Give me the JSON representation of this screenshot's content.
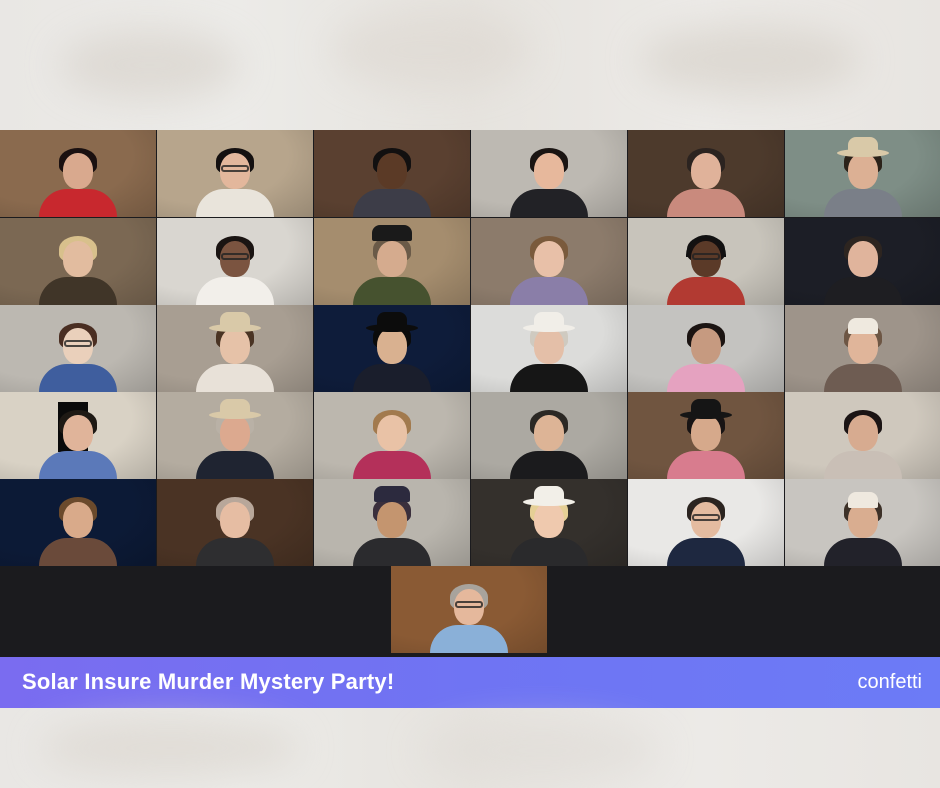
{
  "banner": {
    "title": "Solar Insure Murder Mystery Party!",
    "brand": "confetti"
  },
  "tiles": [
    {
      "row": 0,
      "col": 0,
      "bg": "#8a6a4e",
      "skin": "#d9a98e",
      "hair": "#1a1010",
      "top": "#c8282e",
      "acc": "none",
      "active": false
    },
    {
      "row": 0,
      "col": 1,
      "bg": "#b7a58c",
      "skin": "#e3b79c",
      "hair": "#141010",
      "top": "#e9e4db",
      "acc": "glasses",
      "active": true
    },
    {
      "row": 0,
      "col": 2,
      "bg": "#5a4030",
      "skin": "#5b3a26",
      "hair": "#121010",
      "top": "#3d3d48",
      "acc": "none",
      "active": false
    },
    {
      "row": 0,
      "col": 3,
      "bg": "#bdb9b2",
      "skin": "#e7b89c",
      "hair": "#1a1412",
      "top": "#222226",
      "acc": "none",
      "active": false
    },
    {
      "row": 0,
      "col": 4,
      "bg": "#4d3a2c",
      "skin": "#e0b29a",
      "hair": "#2b2320",
      "top": "#c98a7d",
      "acc": "none",
      "active": false
    },
    {
      "row": 0,
      "col": 5,
      "bg": "#7e8e86",
      "skin": "#dcb094",
      "hair": "#2b2219",
      "top": "#7a7f88",
      "acc": "cowboy",
      "active": false
    },
    {
      "row": 1,
      "col": 0,
      "bg": "#7b6853",
      "skin": "#e2bc9f",
      "hair": "#d8c08c",
      "top": "#403528",
      "acc": "none",
      "active": false
    },
    {
      "row": 1,
      "col": 1,
      "bg": "#d9d6d0",
      "skin": "#7b5440",
      "hair": "#1a1412",
      "top": "#f2efea",
      "acc": "glasses",
      "active": false
    },
    {
      "row": 1,
      "col": 2,
      "bg": "#a58d6e",
      "skin": "#d5ab8e",
      "hair": "#6a5a48",
      "top": "#46522f",
      "acc": "beret",
      "active": false
    },
    {
      "row": 1,
      "col": 3,
      "bg": "#8c7b6b",
      "skin": "#e8c0a8",
      "hair": "#7a5a3c",
      "top": "#8a7ea8",
      "acc": "none",
      "active": false
    },
    {
      "row": 1,
      "col": 4,
      "bg": "#c8c4bb",
      "skin": "#5b3a28",
      "hair": "#141010",
      "top": "#b23a32",
      "acc": "headset",
      "active": false
    },
    {
      "row": 1,
      "col": 5,
      "bg": "#1c1e26",
      "skin": "#e0b49c",
      "hair": "#2d2520",
      "top": "#1e1e22",
      "acc": "none",
      "active": false
    },
    {
      "row": 2,
      "col": 0,
      "bg": "#bcb8b1",
      "skin": "#ead0bb",
      "hair": "#4a2e22",
      "top": "#3f5e9e",
      "acc": "glasses",
      "active": false
    },
    {
      "row": 2,
      "col": 1,
      "bg": "#a89e92",
      "skin": "#e6c2a8",
      "hair": "#4a3424",
      "top": "#e8e1d8",
      "acc": "cowboy",
      "active": false
    },
    {
      "row": 2,
      "col": 2,
      "bg": "#0e1c3a",
      "skin": "#d9b190",
      "hair": "#0b0b0b",
      "top": "#1a1e2c",
      "acc": "tophat",
      "active": false
    },
    {
      "row": 2,
      "col": 3,
      "bg": "#dcdcda",
      "skin": "#e4bfa8",
      "hair": "#cfcac0",
      "top": "#161616",
      "acc": "panama",
      "active": false
    },
    {
      "row": 2,
      "col": 4,
      "bg": "#c4c3c0",
      "skin": "#c69a80",
      "hair": "#1b1412",
      "top": "#e5a2c0",
      "acc": "none",
      "active": false
    },
    {
      "row": 2,
      "col": 5,
      "bg": "#9e948a",
      "skin": "#e0b59a",
      "hair": "#6d5644",
      "top": "#6e5c52",
      "acc": "cap",
      "active": false
    },
    {
      "row": 3,
      "col": 0,
      "bg": "#d9d2c5",
      "skin": "#e0b49a",
      "hair": "#1e1914",
      "top": "#5b79b9",
      "acc": "sign",
      "active": false
    },
    {
      "row": 3,
      "col": 1,
      "bg": "#b4aca0",
      "skin": "#dca98f",
      "hair": "#b9b1a6",
      "top": "#1f2431",
      "acc": "cowboy",
      "active": false
    },
    {
      "row": 3,
      "col": 2,
      "bg": "#bcb7ae",
      "skin": "#e9c2a6",
      "hair": "#a27a4e",
      "top": "#b4305a",
      "acc": "none",
      "active": false
    },
    {
      "row": 3,
      "col": 3,
      "bg": "#aca9a2",
      "skin": "#ddb496",
      "hair": "#2b2824",
      "top": "#1b1b1d",
      "acc": "none",
      "active": false
    },
    {
      "row": 3,
      "col": 4,
      "bg": "#705540",
      "skin": "#d6a98b",
      "hair": "#181414",
      "top": "#d87c8e",
      "acc": "fedora",
      "active": false
    },
    {
      "row": 3,
      "col": 5,
      "bg": "#cfc8bd",
      "skin": "#d7ab90",
      "hair": "#1b1414",
      "top": "#c9bfb6",
      "acc": "none",
      "active": false
    },
    {
      "row": 4,
      "col": 0,
      "bg": "#0c1a36",
      "skin": "#d9aa8a",
      "hair": "#6b4a2c",
      "top": "#6a4a3a",
      "acc": "none",
      "active": false
    },
    {
      "row": 4,
      "col": 1,
      "bg": "#4a3324",
      "skin": "#e6bda3",
      "hair": "#b8a79a",
      "top": "#2e2e30",
      "acc": "none",
      "active": false
    },
    {
      "row": 4,
      "col": 2,
      "bg": "#b9b5ad",
      "skin": "#c4956f",
      "hair": "#3a2f3c",
      "top": "#2b2b2e",
      "acc": "turban",
      "active": false
    },
    {
      "row": 4,
      "col": 3,
      "bg": "#34302c",
      "skin": "#efc9ae",
      "hair": "#e5cf95",
      "top": "#2a2a2c",
      "acc": "cowboy-white",
      "active": false
    },
    {
      "row": 4,
      "col": 4,
      "bg": "#e9e8e6",
      "skin": "#e4bba0",
      "hair": "#2b2420",
      "top": "#1e2840",
      "acc": "glasses",
      "active": false
    },
    {
      "row": 4,
      "col": 5,
      "bg": "#c8c5c0",
      "skin": "#d9ad90",
      "hair": "#3d3128",
      "top": "#22222a",
      "acc": "cap",
      "active": false
    },
    {
      "row": 5,
      "col": 2.5,
      "bg": "#8a5a34",
      "skin": "#e5b89c",
      "hair": "#a8a39c",
      "top": "#8ab0d8",
      "acc": "glasses",
      "active": false
    }
  ]
}
